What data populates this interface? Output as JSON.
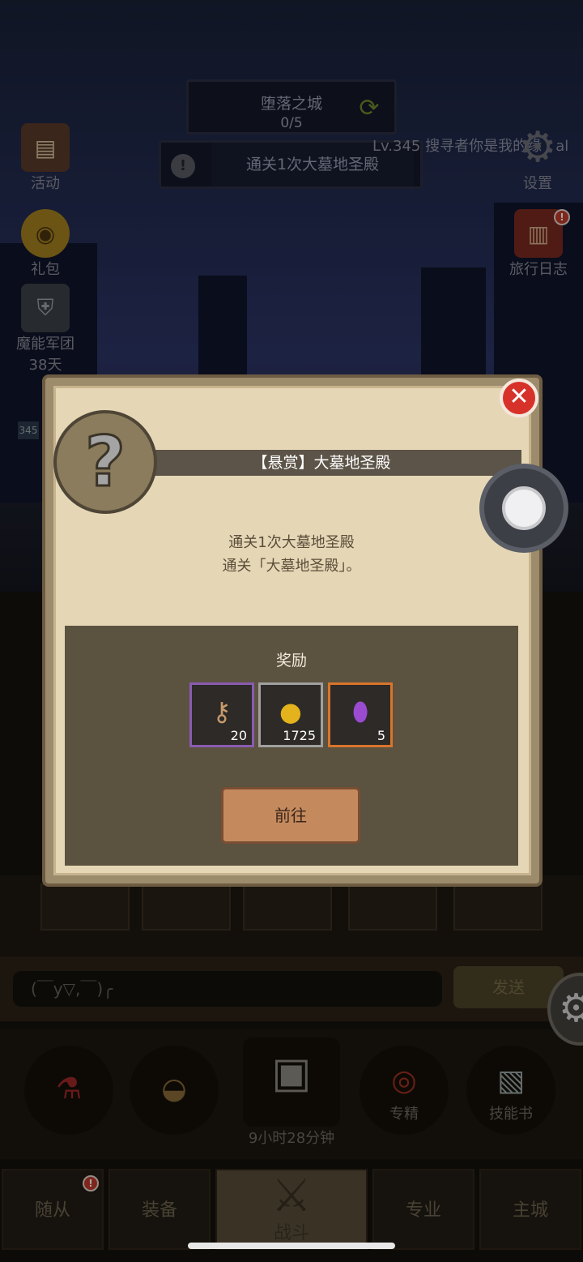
{
  "hud": {
    "stage_title": "堕落之城",
    "stage_progress": "0/5",
    "quest_text": "通关1次大墓地圣殿",
    "player_line": "Lv.345 搜寻者你是我的缘 · al"
  },
  "left_menu": [
    {
      "label": "活动"
    },
    {
      "label": "礼包"
    },
    {
      "label": "魔能军团",
      "sub": "38天"
    }
  ],
  "right_menu": [
    {
      "label": "设置"
    },
    {
      "label": "旅行日志",
      "badge": "!"
    }
  ],
  "level_tag": "345",
  "modal": {
    "title": "【悬赏】大墓地圣殿",
    "desc_line1": "通关1次大墓地圣殿",
    "desc_line2": "通关「大墓地圣殿」。",
    "reward_title": "奖励",
    "rewards": [
      {
        "icon": "key-icon",
        "count": "20",
        "rarity_color": "#8a5bb0"
      },
      {
        "icon": "gold-coin-icon",
        "count": "1725",
        "rarity_color": "#a0a0a0"
      },
      {
        "icon": "purple-gem-icon",
        "count": "5",
        "rarity_color": "#d9752a"
      }
    ],
    "goto_label": "前往",
    "close_glyph": "✕",
    "portrait_glyph": "?"
  },
  "chat": {
    "input_value": "(￣y▽,￣)╭",
    "send_label": "发送"
  },
  "skills": {
    "chest_timer": "9小时28分钟",
    "specialty_label": "专精",
    "skillbook_label": "技能书"
  },
  "nav": {
    "tabs": [
      {
        "label": "随从",
        "badge": "!"
      },
      {
        "label": "装备"
      },
      {
        "label": "战斗"
      },
      {
        "label": "专业"
      },
      {
        "label": "主城"
      }
    ]
  }
}
